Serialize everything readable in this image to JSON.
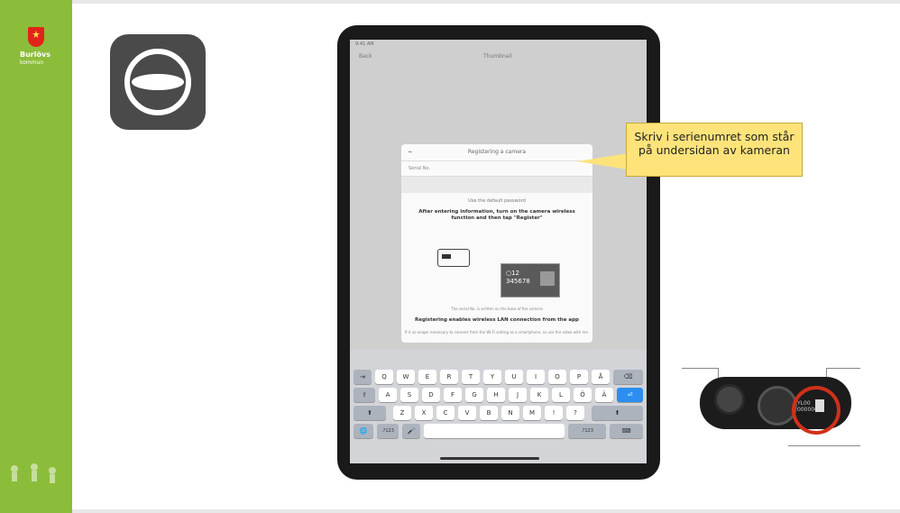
{
  "sidebar": {
    "org_name": "Burlövs",
    "org_sub": "kommun",
    "colors": {
      "sidebar": "#8cbd3a",
      "crest": "#e2231a"
    }
  },
  "app_icon": {
    "name": "camera-app-icon"
  },
  "ipad": {
    "status_time": "9:41 AM",
    "nav_left": "Back",
    "nav_title": "Thumbnail",
    "dialog": {
      "title": "Registering a camera",
      "back": "←",
      "serial_label": "Serial No.",
      "password_option": "Use the default password",
      "instruction": "After entering information, turn on the camera wireless function and then tap \"Register\"",
      "tag_prefix": "○12",
      "tag_number": "345678",
      "caption": "The serial No. is written on the base of the camera",
      "footer": "Registering enables wireless LAN connection from the app",
      "footer_small": "If it no longer necessary to connect from the Wi-Fi setting as a smartphone, so use the video with me."
    },
    "keyboard": {
      "row1": [
        "Q",
        "W",
        "E",
        "R",
        "T",
        "Y",
        "U",
        "I",
        "O",
        "P",
        "Å"
      ],
      "row2": [
        "A",
        "S",
        "D",
        "F",
        "G",
        "H",
        "J",
        "K",
        "L",
        "Ö",
        "Ä"
      ],
      "row3": [
        "Z",
        "X",
        "C",
        "V",
        "B",
        "N",
        "M",
        "!",
        "?"
      ],
      "tab_key": "⇥",
      "caps_key": "⇪",
      "shift_key": "⬆",
      "delete_key": "⌫",
      "return_key": "⏎",
      "globe_key": "🌐",
      "num_key": ".?123",
      "mic_key": "🎤",
      "kbd_key": "⌨"
    }
  },
  "callout": {
    "text": "Skriv i serienumret som står på undersidan av kameran",
    "color": "#fde37a"
  },
  "camera_photo": {
    "label_line1": "YL00",
    "label_line2": "000000",
    "highlight_color": "#d0301a"
  }
}
